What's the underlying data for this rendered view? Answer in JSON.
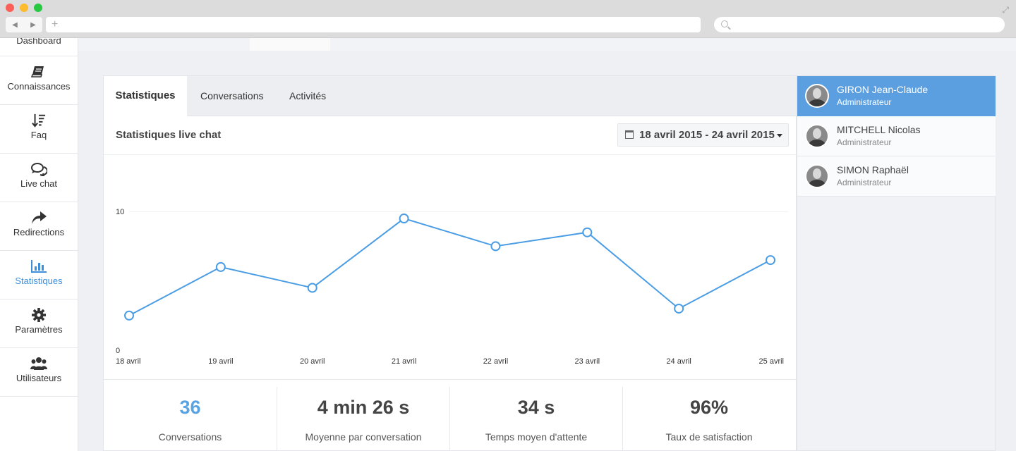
{
  "browser": {
    "url": "",
    "new_tab_label": "+",
    "back_icon": "back-arrow-icon",
    "forward_icon": "forward-arrow-icon",
    "search_placeholder": ""
  },
  "sidebar": {
    "top_label": "Dashboard",
    "items": [
      {
        "label": "Connaissances",
        "icon": "book-icon"
      },
      {
        "label": "Faq",
        "icon": "sort-icon"
      },
      {
        "label": "Live chat",
        "icon": "chat-icon"
      },
      {
        "label": "Redirections",
        "icon": "share-icon"
      },
      {
        "label": "Statistiques",
        "icon": "bar-chart-icon"
      },
      {
        "label": "Paramètres",
        "icon": "gear-icon"
      },
      {
        "label": "Utilisateurs",
        "icon": "users-icon"
      }
    ],
    "active_item": "Statistiques"
  },
  "main": {
    "tabs": [
      {
        "label": "Statistiques"
      },
      {
        "label": "Conversations"
      },
      {
        "label": "Activités"
      }
    ],
    "section_title": "Statistiques live chat",
    "date_range": "18 avril 2015 - 24 avril 2015"
  },
  "chart_data": {
    "type": "line",
    "categories": [
      "18 avril",
      "19 avril",
      "20 avril",
      "21 avril",
      "22 avril",
      "23 avril",
      "24 avril",
      "25 avril"
    ],
    "values": [
      2.5,
      6,
      4.5,
      9.5,
      7.5,
      8.5,
      3,
      6.5
    ],
    "ylim": [
      0,
      12.5
    ],
    "ytick_labels": [
      "0",
      "10"
    ],
    "color": "#4a9de4",
    "grid": true
  },
  "kpis": [
    {
      "value": "36",
      "label": "Conversations"
    },
    {
      "value": "4 min 26 s",
      "label": "Moyenne par conversation"
    },
    {
      "value": "34 s",
      "label": "Temps moyen d'attente"
    },
    {
      "value": "96%",
      "label": "Taux de satisfaction"
    }
  ],
  "users": [
    {
      "name": "GIRON Jean-Claude",
      "role": "Administrateur"
    },
    {
      "name": "MITCHELL Nicolas",
      "role": "Administrateur"
    },
    {
      "name": "SIMON Raphaël",
      "role": "Administrateur"
    }
  ],
  "colors": {
    "accent": "#5aa3e3",
    "active_user": "#5b9fe0",
    "line": "#4a9de4"
  }
}
